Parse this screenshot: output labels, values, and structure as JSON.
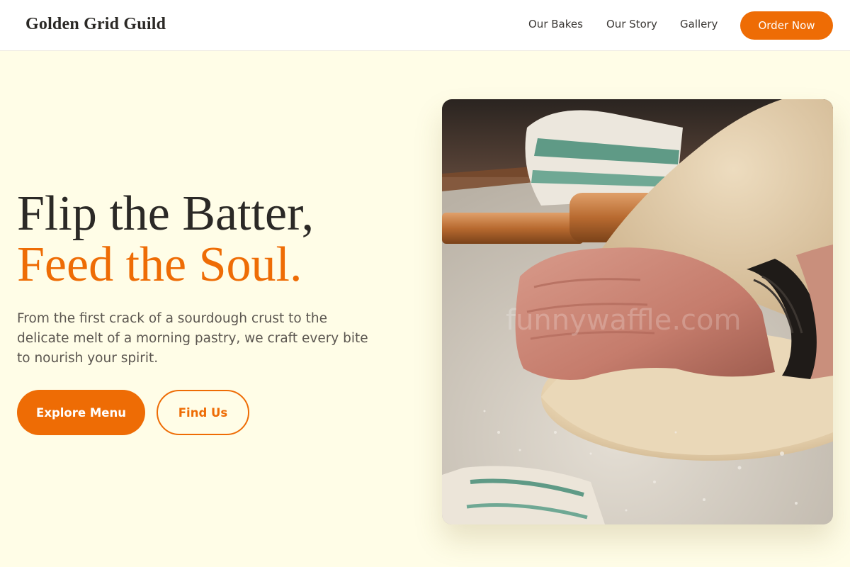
{
  "header": {
    "brand": "Golden Grid Guild",
    "nav": [
      {
        "label": "Our Bakes"
      },
      {
        "label": "Our Story"
      },
      {
        "label": "Gallery"
      }
    ],
    "cta_label": "Order Now"
  },
  "hero": {
    "title_line1": "Flip the Batter,",
    "title_line2": "Feed the Soul.",
    "description": "From the first crack of a sourdough crust to the delicate melt of a morning pastry, we craft every bite to nourish your spirit.",
    "primary_button": "Explore Menu",
    "secondary_button": "Find Us",
    "image_watermark": "funnywaffle.com"
  },
  "colors": {
    "accent": "#ee6c05",
    "background": "#fffde7",
    "text": "#2b2926"
  }
}
